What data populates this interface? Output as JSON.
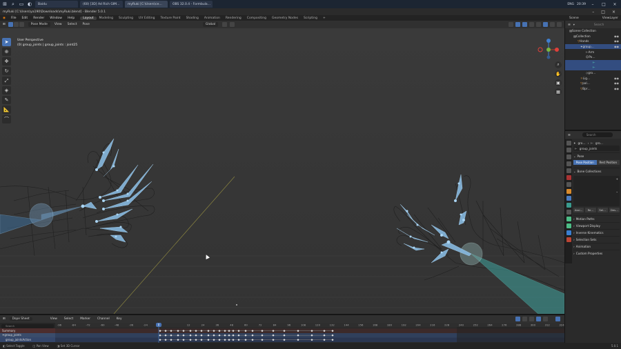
{
  "taskbar": {
    "tabs": [
      "Baidu",
      "(60) [3D] Ad Rich GIM…",
      "myRuki [C:\\Users\\ce…",
      "OBS 32.0.4 - Formbula…"
    ],
    "lang": "ENG",
    "time": "20:39"
  },
  "window": {
    "title": "myRuki [C:\\Users\\ya190\\Downloads\\myRuki.blend] - Blender 5.0.1"
  },
  "menu": {
    "items": [
      "File",
      "Edit",
      "Render",
      "Window",
      "Help"
    ],
    "workspaces": [
      "Layout",
      "Modeling",
      "Sculpting",
      "UV Editing",
      "Texture Paint",
      "Shading",
      "Animation",
      "Rendering",
      "Compositing",
      "Geometry Nodes",
      "Scripting"
    ],
    "active_workspace": "Layout",
    "add_tab": "+",
    "scene": "Scene",
    "view_layer": "ViewLayer"
  },
  "viewport_header": {
    "mode": "Pose Mode",
    "view": "View",
    "select": "Select",
    "pose": "Pose",
    "orientation": "Global",
    "pose_options": "Pose Options"
  },
  "viewport": {
    "view_name": "User Perspective",
    "context": "(0) group_joints | group_joints : joint25"
  },
  "outliner": {
    "search_placeholder": "Search",
    "rows": [
      "Scene Collection",
      "Collection",
      "Hands",
      "group…",
      "Arm",
      "Po…",
      "",
      "",
      "gro…",
      "Lig…",
      "pal…",
      "Bpr…"
    ]
  },
  "properties": {
    "search_placeholder": "Search",
    "breadcrumb_a": "gro…",
    "breadcrumb_b": "gro…",
    "armature_name": "group_joints",
    "panel_pose": "Pose",
    "pose_position": "Pose Position",
    "rest_position": "Rest Position",
    "panel_bone_collections": "Bone Collections",
    "assign": "Assi…",
    "remove": "Re…",
    "select": "Sel…",
    "deselect": "Des…",
    "panels": [
      "Motion Paths",
      "Viewport Display",
      "Inverse Kinematics",
      "Selection Sets",
      "Animation",
      "Custom Properties"
    ]
  },
  "dopesheet": {
    "editor": "Dope Sheet",
    "menu": [
      "View",
      "Select",
      "Marker",
      "Channel",
      "Key"
    ],
    "search_placeholder": "Search",
    "channels": [
      "Summary",
      "group_joints",
      "group_jointsAction"
    ],
    "current_frame": "0",
    "frame_labels": [
      "-96",
      "-84",
      "-72",
      "-60",
      "-48",
      "-36",
      "-24",
      "-12",
      "0",
      "12",
      "24",
      "36",
      "48",
      "60",
      "72",
      "84",
      "96",
      "108",
      "120",
      "132",
      "144",
      "156",
      "168",
      "180",
      "192",
      "204",
      "216",
      "228",
      "240",
      "252",
      "264",
      "276",
      "288",
      "300",
      "312",
      "324"
    ]
  },
  "status": {
    "select": "Select Toggle",
    "pan": "Pan View",
    "cursor": "Set 3D Cursor",
    "version": "5.0.1"
  },
  "colors": {
    "accent": "#4772b3",
    "bone": "#7fb2dc",
    "bone_active": "#56bdb5",
    "summary_row": "#4c2d2d"
  }
}
